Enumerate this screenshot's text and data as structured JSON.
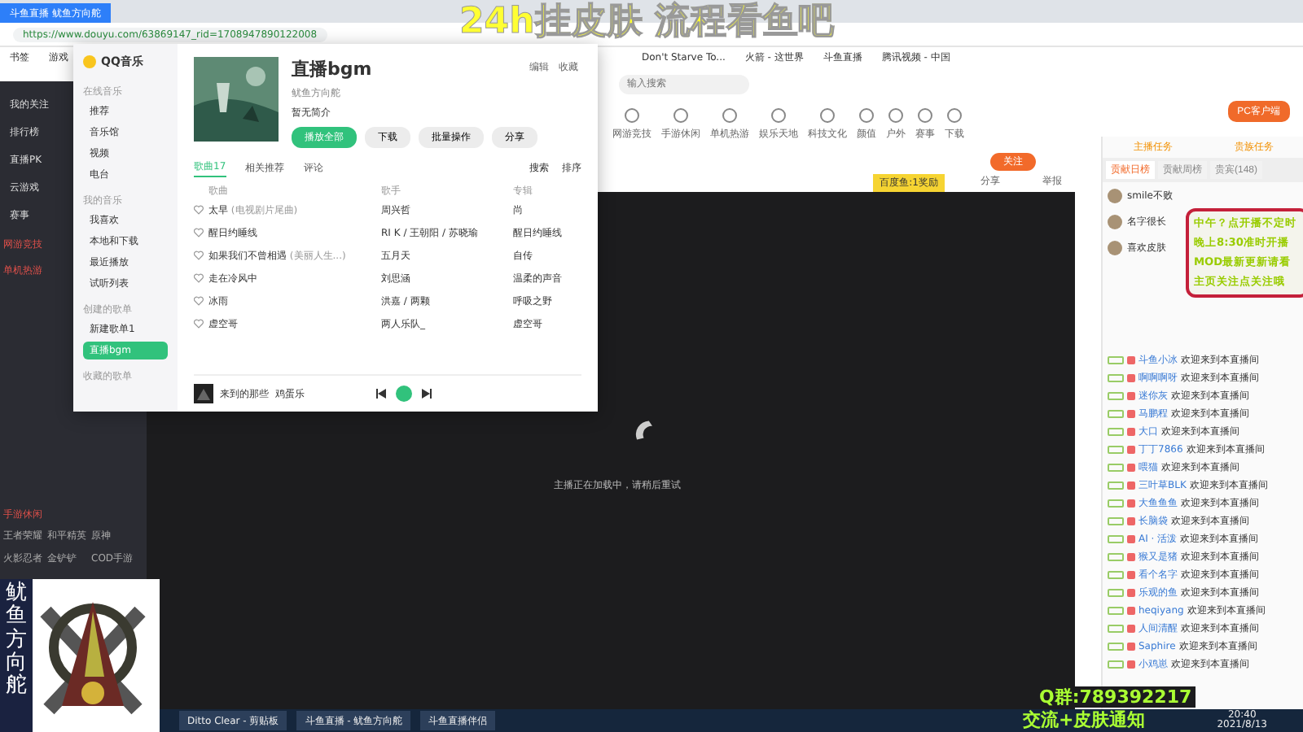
{
  "browser": {
    "tab_title": "斗鱼直播 鱿鱼方向舵",
    "url": "https://www.douyu.com/63869147_rid=1708947890122008",
    "bookmarks": [
      "书签",
      "游戏",
      "Don't Starve To...",
      "火箭 - 这世界",
      "斗鱼直播",
      "腾讯视频 - 中国"
    ]
  },
  "site_nav": {
    "search_placeholder": "输入搜索",
    "categories": [
      "网游竞技",
      "手游休闲",
      "单机热游",
      "娱乐天地",
      "科技文化",
      "颜值",
      "户外",
      "赛事",
      "下载"
    ],
    "pc_button": "PC客户端"
  },
  "left_nav": {
    "items": [
      "我的关注",
      "排行榜",
      "直播PK",
      "云游戏",
      "赛事"
    ],
    "sections": [
      {
        "title": "网游竞技"
      },
      {
        "title": "单机热游"
      },
      {
        "title": "手游休闲",
        "games": [
          "王者荣耀",
          "和平精英",
          "原神",
          "火影忍者",
          "金铲铲",
          "COD手游"
        ]
      }
    ]
  },
  "player": {
    "follow_label": "关注",
    "room_badge": "百度鱼:1奖励",
    "share": "分享",
    "report": "举报",
    "loading": "主播正在加载中，请稍后重试"
  },
  "qq_music": {
    "app_name": "QQ音乐",
    "sidebar": [
      {
        "heading": "在线音乐",
        "items": [
          {
            "label": "推荐",
            "selected": false
          },
          {
            "label": "音乐馆",
            "selected": false
          },
          {
            "label": "视频",
            "selected": false
          },
          {
            "label": "电台",
            "selected": false
          }
        ]
      },
      {
        "heading": "我的音乐",
        "items": [
          {
            "label": "我喜欢",
            "selected": false
          },
          {
            "label": "本地和下载",
            "selected": false
          },
          {
            "label": "最近播放",
            "selected": false
          },
          {
            "label": "试听列表",
            "selected": false
          }
        ]
      },
      {
        "heading": "创建的歌单",
        "items": [
          {
            "label": "新建歌单1",
            "selected": false
          },
          {
            "label": "直播bgm",
            "selected": true
          }
        ]
      },
      {
        "heading": "收藏的歌单"
      }
    ],
    "playlist": {
      "title": "直播bgm",
      "owner": "鱿鱼方向舵",
      "description": "暂无简介",
      "actions": [
        "播放全部",
        "下载",
        "批量操作",
        "分享"
      ],
      "edit": "编辑",
      "collect": "收藏"
    },
    "tabs": [
      {
        "label": "歌曲17",
        "selected": true
      },
      {
        "label": "相关推荐",
        "selected": false
      },
      {
        "label": "评论",
        "selected": false
      }
    ],
    "tools": [
      "搜索",
      "排序"
    ],
    "columns": [
      "歌曲",
      "歌手",
      "专辑"
    ],
    "songs": [
      {
        "title": "太早",
        "note": "(电视剧片尾曲)",
        "liked": false,
        "singer": "周兴哲",
        "album": "尚"
      },
      {
        "title": "醒日约睡线",
        "liked": false,
        "singer": "RI K / 王朝阳 / 苏晓瑜",
        "album": "醒日约睡线"
      },
      {
        "title": "如果我们不曾相遇",
        "note": "(美丽人生...)",
        "liked": false,
        "singer": "五月天",
        "album": "自传"
      },
      {
        "title": "走在冷风中",
        "liked": false,
        "singer": "刘思涵",
        "album": "温柔的声音"
      },
      {
        "title": "冰雨",
        "liked": false,
        "singer": "洪嘉 / 两颗",
        "album": "呼吸之野"
      },
      {
        "title": "虚空哥",
        "liked": false,
        "singer": "两人乐队_",
        "album": "虚空哥"
      }
    ],
    "now_playing": {
      "title": "来到的那些",
      "artist": "鸡蛋乐"
    }
  },
  "chat": {
    "tabs": [
      "主播任务",
      "贵族任务"
    ],
    "rank_tabs": [
      {
        "label": "贡献日榜",
        "selected": true
      },
      {
        "label": "贡献周榜",
        "selected": false
      },
      {
        "label": "贵宾(148)",
        "selected": false
      }
    ],
    "top_fans": [
      {
        "name": "smile不败"
      },
      {
        "name": "名字很长"
      },
      {
        "name": "喜欢皮肤"
      }
    ],
    "messages": [
      {
        "user": "斗鱼小冰",
        "text": "欢迎来到本直播间"
      },
      {
        "user": "啊啊啊呀",
        "text": "欢迎来到本直播间"
      },
      {
        "user": "迷你灰",
        "text": "欢迎来到本直播间"
      },
      {
        "user": "马鹏程",
        "text": "欢迎来到本直播间"
      },
      {
        "user": "大口",
        "text": "欢迎来到本直播间"
      },
      {
        "user": "丁丁7866",
        "text": "欢迎来到本直播间"
      },
      {
        "user": "喂猫",
        "text": "欢迎来到本直播间"
      },
      {
        "user": "三叶草BLK",
        "text": "欢迎来到本直播间"
      },
      {
        "user": "大鱼鱼鱼",
        "text": "欢迎来到本直播间"
      },
      {
        "user": "长脑袋",
        "text": "欢迎来到本直播间"
      },
      {
        "user": "AI · 活泼",
        "text": "欢迎来到本直播间"
      },
      {
        "user": "猴又是猪",
        "text": "欢迎来到本直播间"
      },
      {
        "user": "看个名字",
        "text": "欢迎来到本直播间"
      },
      {
        "user": "乐观的鱼",
        "text": "欢迎来到本直播间"
      },
      {
        "user": "heqiyang",
        "text": "欢迎来到本直播间"
      },
      {
        "user": "人间清醒",
        "text": "欢迎来到本直播间"
      },
      {
        "user": "Saphire",
        "text": "欢迎来到本直播间"
      },
      {
        "user": "小鸡崽",
        "text": "欢迎来到本直播间"
      }
    ]
  },
  "overlay": {
    "headline": "24h挂皮肤 流程看鱼吧",
    "notice": [
      "中午？点开播不定时",
      "晚上8:30准时开播",
      "MOD最新更新请看",
      "主页关注点关注哦"
    ],
    "logo_text": "鱿鱼方向舵",
    "qq_group": "Q群:789392217",
    "qq_caption": "交流+皮肤通知"
  },
  "taskbar": {
    "apps": [
      "Ditto Clear - 剪贴板",
      "斗鱼直播 - 鱿鱼方向舵",
      "斗鱼直播伴侣"
    ],
    "time": "20:40",
    "date": "2021/8/13"
  }
}
